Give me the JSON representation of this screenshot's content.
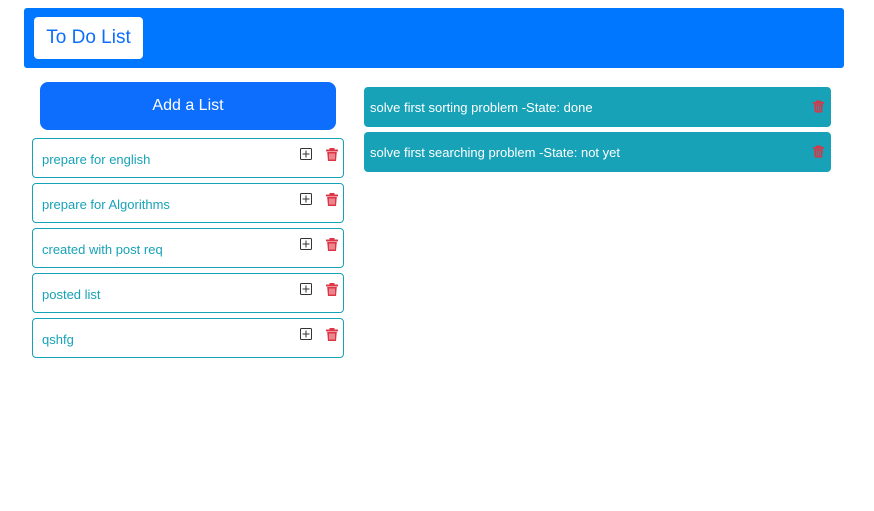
{
  "navbar": {
    "brand": "To Do List",
    "background_color": "#0077ff"
  },
  "add_list_button": {
    "label": "Add a List",
    "color": "#0d6efd"
  },
  "lists": [
    {
      "name": "prepare for english"
    },
    {
      "name": "prepare for Algorithms"
    },
    {
      "name": "created with post req"
    },
    {
      "name": "posted list"
    },
    {
      "name": "qshfg"
    }
  ],
  "list_icons": {
    "add": "plus-square-icon",
    "delete": "trash-icon"
  },
  "tasks": [
    {
      "text": "solve first sorting problem -State: done"
    },
    {
      "text": "solve first searching problem -State: not yet"
    }
  ],
  "colors": {
    "accent": "#17a2b8",
    "danger": "#dc3545"
  }
}
